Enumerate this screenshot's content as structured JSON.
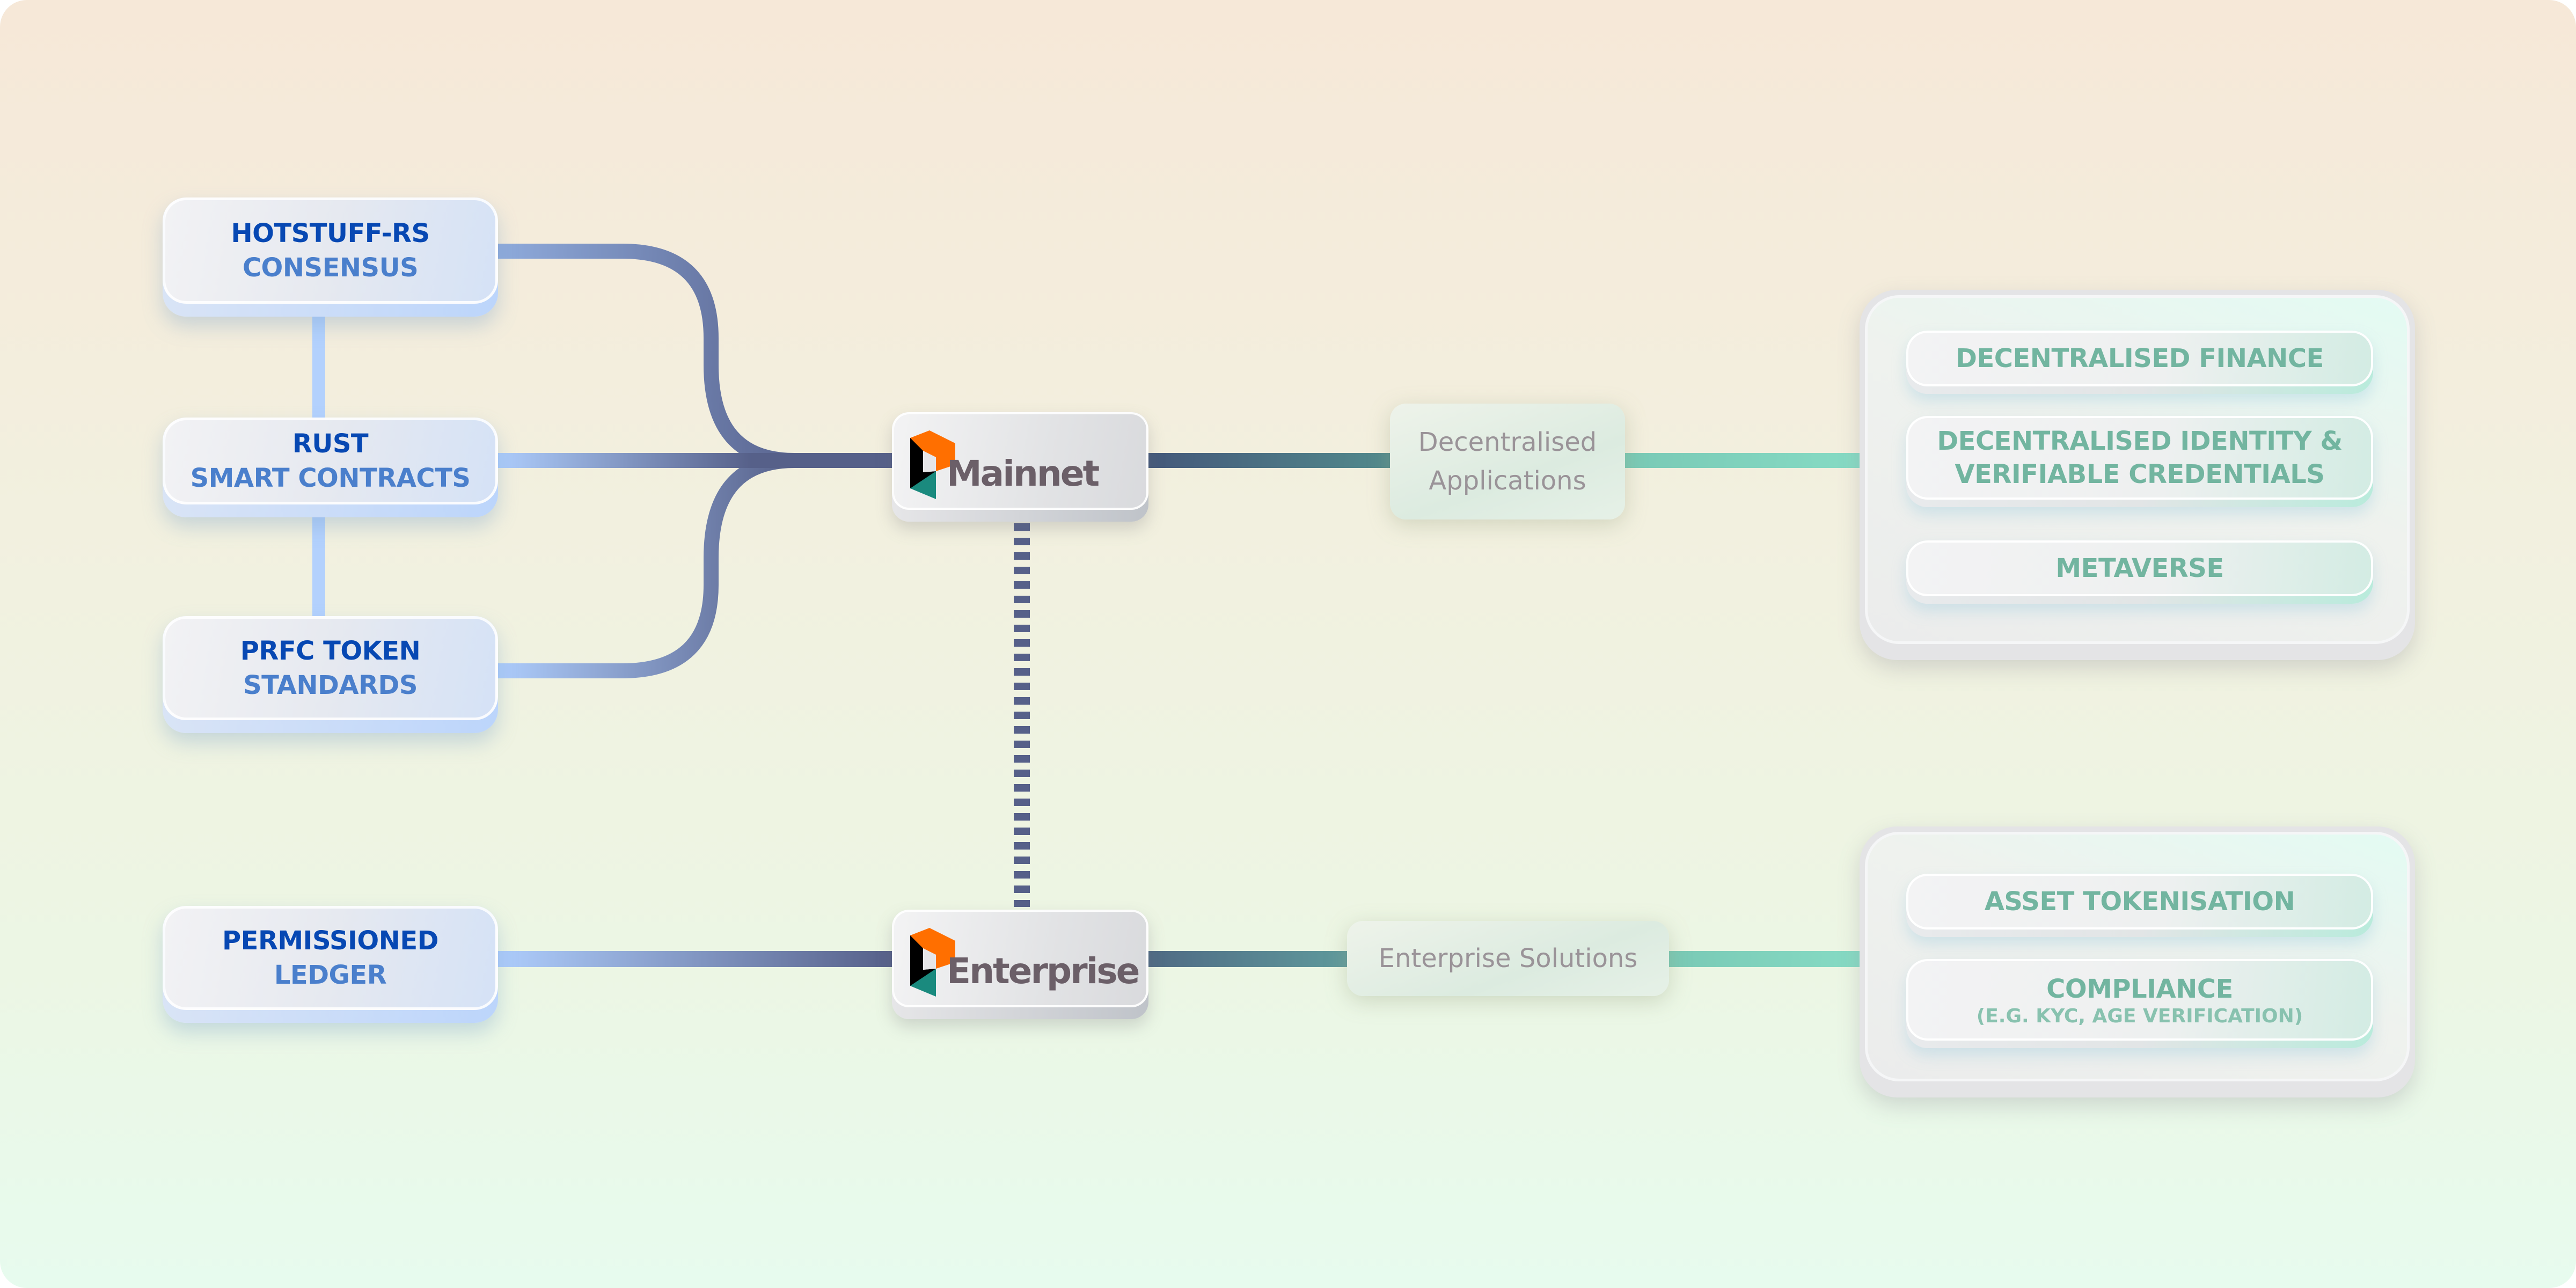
{
  "colors": {
    "feature_title": "#0748b3",
    "feature_subtitle": "#4a7fcc",
    "wire_light": "#aecdfc",
    "wire_dark": "#566089",
    "wire_teal_dark": "#44607a",
    "wire_teal_light": "#86dbc4",
    "logo_orange": "#ff6f00",
    "logo_black": "#000000",
    "logo_teal": "#1a8a7e",
    "network_text": "#6b5f68",
    "category_text": "#9a9398",
    "usecase_text": "#72b5a0"
  },
  "features": [
    {
      "line1": "HOTSTUFF-RS",
      "line2": "CONSENSUS"
    },
    {
      "line1": "RUST",
      "line2": "SMART CONTRACTS"
    },
    {
      "line1": "PRFC TOKEN",
      "line2": "STANDARDS"
    },
    {
      "line1": "PERMISSIONED",
      "line2": "LEDGER"
    }
  ],
  "networks": {
    "mainnet": {
      "name": "Mainnet",
      "icon": "parallelchain-logo-icon"
    },
    "enterprise": {
      "name": "Enterprise",
      "icon": "parallelchain-logo-icon"
    }
  },
  "categories": {
    "dapps": {
      "line1": "Decentralised",
      "line2": "Applications"
    },
    "enterprise_solutions": {
      "line1": "Enterprise Solutions"
    }
  },
  "use_cases": {
    "mainnet": [
      {
        "title": "DECENTRALISED FINANCE"
      },
      {
        "title": "DECENTRALISED IDENTITY &",
        "title2": "VERIFIABLE CREDENTIALS"
      },
      {
        "title": "METAVERSE"
      }
    ],
    "enterprise": [
      {
        "title": "ASSET TOKENISATION"
      },
      {
        "title": "COMPLIANCE",
        "subtitle": "(E.G. KYC, AGE VERIFICATION)"
      }
    ]
  }
}
